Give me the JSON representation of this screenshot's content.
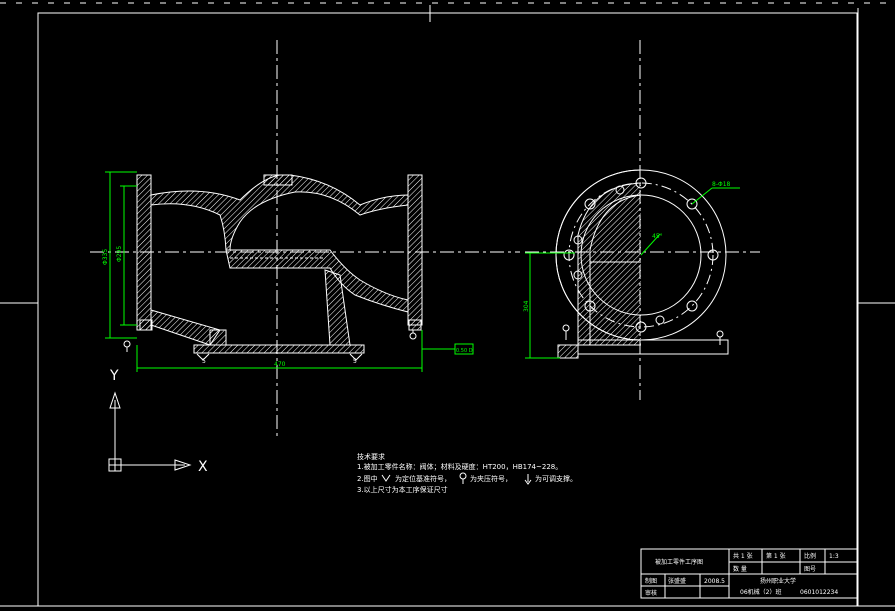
{
  "colors": {
    "background": "#000000",
    "line": "#ffffff",
    "dimension": "#00ff00",
    "hatch": "#ffffff"
  },
  "ucs": {
    "y_label": "Y",
    "x_label": "X"
  },
  "dimensions": {
    "overall_length": "470",
    "height_left_outer": "Φ335",
    "height_left_inner": "Φ295",
    "height_right": "304",
    "bolt_hole": "8-Φ18",
    "angle": "45°",
    "tolerance": "0.50 D",
    "mark_left": "5",
    "mark_right": "5"
  },
  "notes": {
    "heading": "技术要求",
    "line1": "1.被加工零件名称：阀体；材料及硬度：HT200，HB174~228。",
    "line2_a": "2.图中",
    "line2_b": "为定位基准符号，",
    "line2_c": "为夹压符号，",
    "line2_d": "为可调支撑。",
    "line3": "3.以上尺寸为本工序保证尺寸"
  },
  "title_block": {
    "drawing_name": "被加工零件工序图",
    "sheets_total": "共 1 张",
    "sheet_no": "第 1 张",
    "scale_label": "比例",
    "scale_value": "1:3",
    "quantity_label": "数 量",
    "drawing_no_label": "图号",
    "drawn_label": "制图",
    "drawn_name": "张盛盛",
    "date": "2008.5",
    "checked_label": "审核",
    "school": "扬州职业大学",
    "class_info": "06机械（2）班",
    "student_no": "0601012234"
  }
}
